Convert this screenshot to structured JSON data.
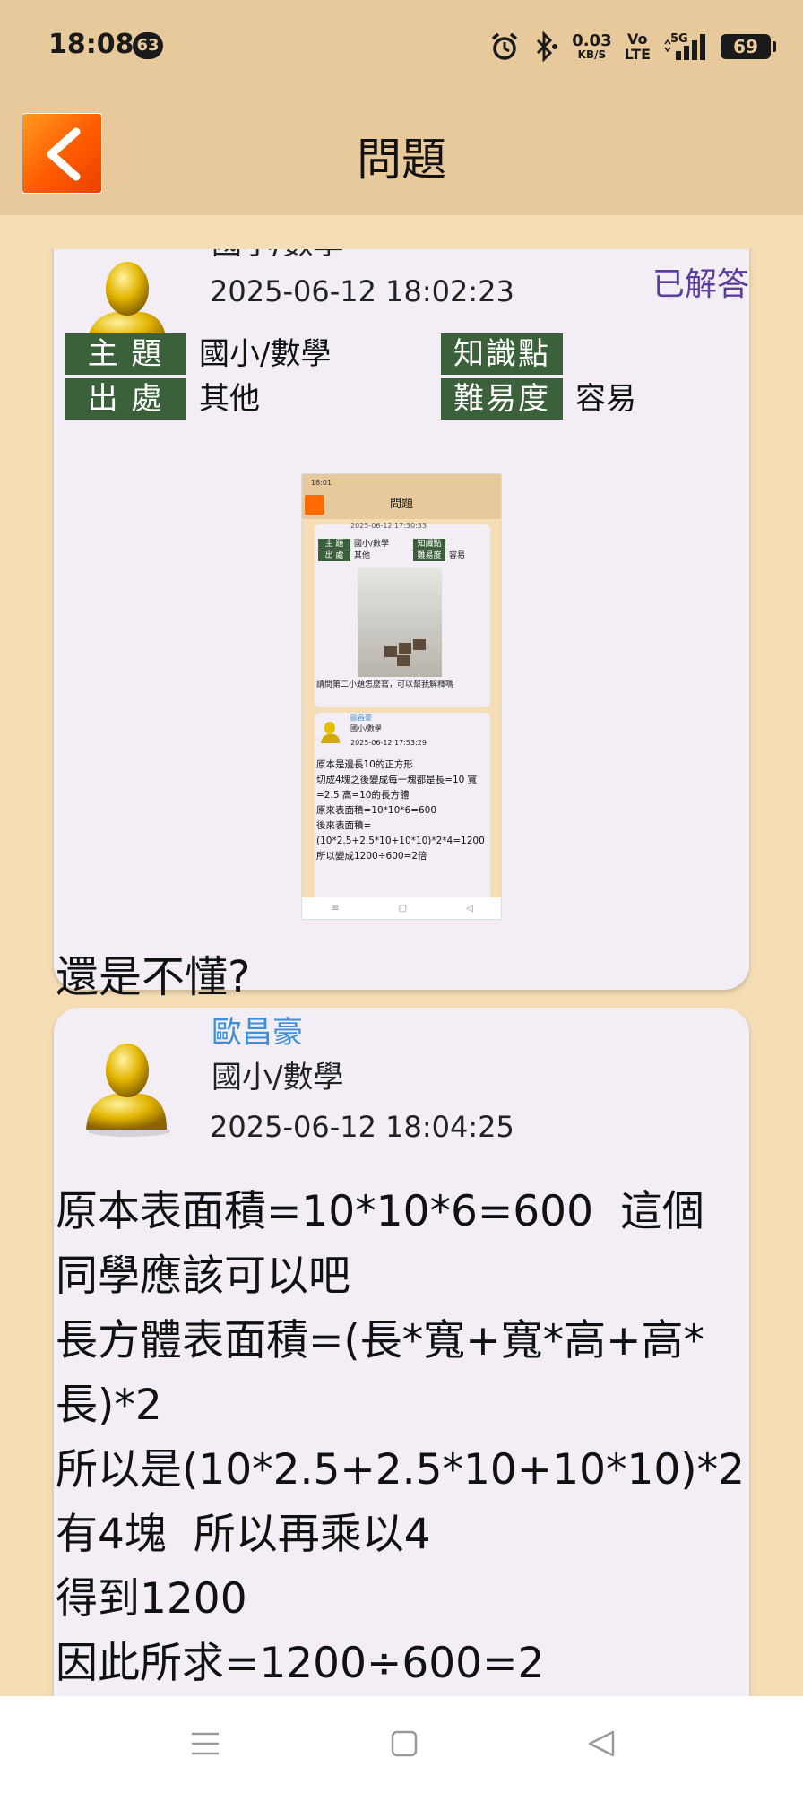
{
  "status_bar": {
    "time": "18:08",
    "badge": "63",
    "speed_value": "0.03",
    "speed_unit": "KB/S",
    "volte_top": "Vo",
    "volte_bottom": "LTE",
    "network": "5G",
    "battery": "69"
  },
  "header": {
    "title": "問題"
  },
  "question": {
    "topic_partial": "國小/數學",
    "date": "2025-06-12 18:02:23",
    "status": "已解答",
    "labels": {
      "subject": "主 題",
      "source": "出 處",
      "knowledge": "知識點",
      "difficulty": "難易度"
    },
    "values": {
      "subject": "國小/數學",
      "source": "其他",
      "knowledge": "",
      "difficulty": "容易"
    },
    "followup": "還是不懂?"
  },
  "thumbnail": {
    "status_time": "18:01",
    "title": "問題",
    "q_date": "2025-06-12 17:30:33",
    "labels": {
      "subject": "主 題",
      "source": "出 處",
      "knowledge": "知識點",
      "difficulty": "難易度"
    },
    "values": {
      "subject": "國小/數學",
      "source": "其他",
      "difficulty": "容易"
    },
    "question_text": "請問第二小題怎麼寫，可以幫我解釋嗎",
    "answer_name": "歐昌豪",
    "answer_topic": "國小/數學",
    "answer_date": "2025-06-12 17:53:29",
    "answer_text": "原本是邊長10的正方形\n切成4塊之後變成每一塊都是長=10  寬=2.5  高=10的長方體\n原來表面積=10*10*6=600\n後來表面積=(10*2.5+2.5*10+10*10)*2*4=1200\n所以變成1200÷600=2倍"
  },
  "answer": {
    "name": "歐昌豪",
    "topic": "國小/數學",
    "date": "2025-06-12 18:04:25",
    "body": "原本表面積=10*10*6=600  這個同學應該可以吧\n長方體表面積=(長*寬+寬*高+高*長)*2\n所以是(10*2.5+2.5*10+10*10)*2\n有4塊  所以再乘以4\n得到1200\n因此所求=1200÷600=2"
  },
  "colors": {
    "background": "#f5deb6",
    "header": "#e8c99c",
    "card": "#f3eef6",
    "label_green": "#3b613a",
    "name_blue": "#3d8fd8",
    "status_purple": "#5a3e9b",
    "back_orange": "#ff6a00"
  },
  "icons": [
    "alarm-icon",
    "bluetooth-icon",
    "signal-icon",
    "battery-icon",
    "back-arrow-icon",
    "avatar-icon",
    "menu-icon",
    "home-icon",
    "back-triangle-icon"
  ]
}
